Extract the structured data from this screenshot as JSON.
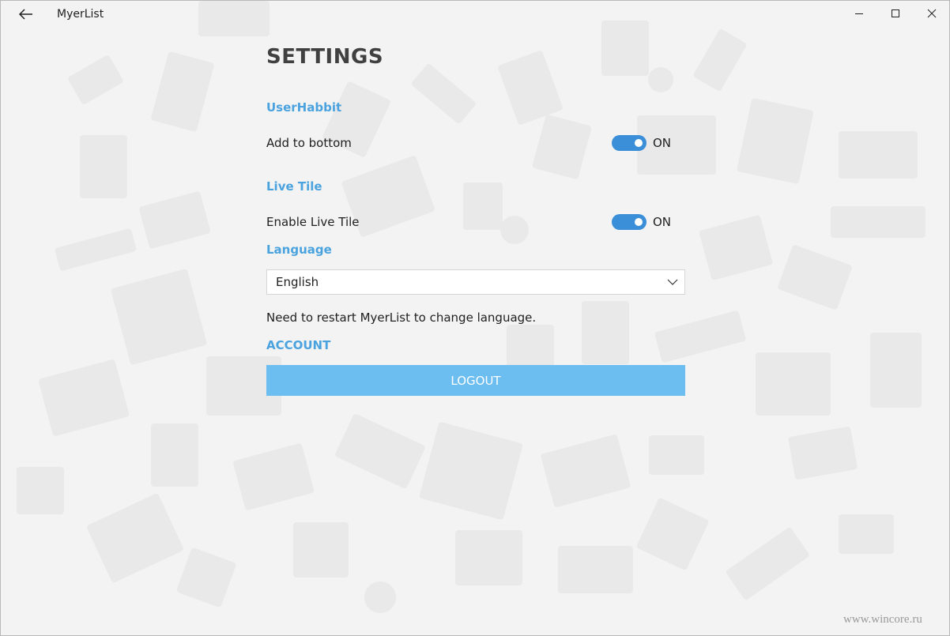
{
  "titlebar": {
    "app_title": "MyerList",
    "back_icon": "arrow-left-icon",
    "minimize_icon": "minimize-icon",
    "maximize_icon": "maximize-icon",
    "close_icon": "close-icon"
  },
  "settings": {
    "title": "SETTINGS",
    "user_habbit": {
      "header": "UserHabbit",
      "add_to_bottom": {
        "label": "Add to bottom",
        "enabled": true,
        "state_label": "ON"
      }
    },
    "live_tile": {
      "header": "Live Tile",
      "enable_live_tile": {
        "label": "Enable Live Tile",
        "enabled": true,
        "state_label": "ON"
      }
    },
    "language": {
      "header": "Language",
      "selected": "English",
      "restart_note": "Need to restart MyerList to change language."
    },
    "account": {
      "header": "ACCOUNT",
      "logout_label": "LOGOUT"
    }
  },
  "watermark": "www.wincore.ru",
  "colors": {
    "accent": "#4aa3df",
    "toggle_on": "#3a8fd8",
    "logout_button": "#6cbdf0",
    "background": "#f3f3f3"
  }
}
